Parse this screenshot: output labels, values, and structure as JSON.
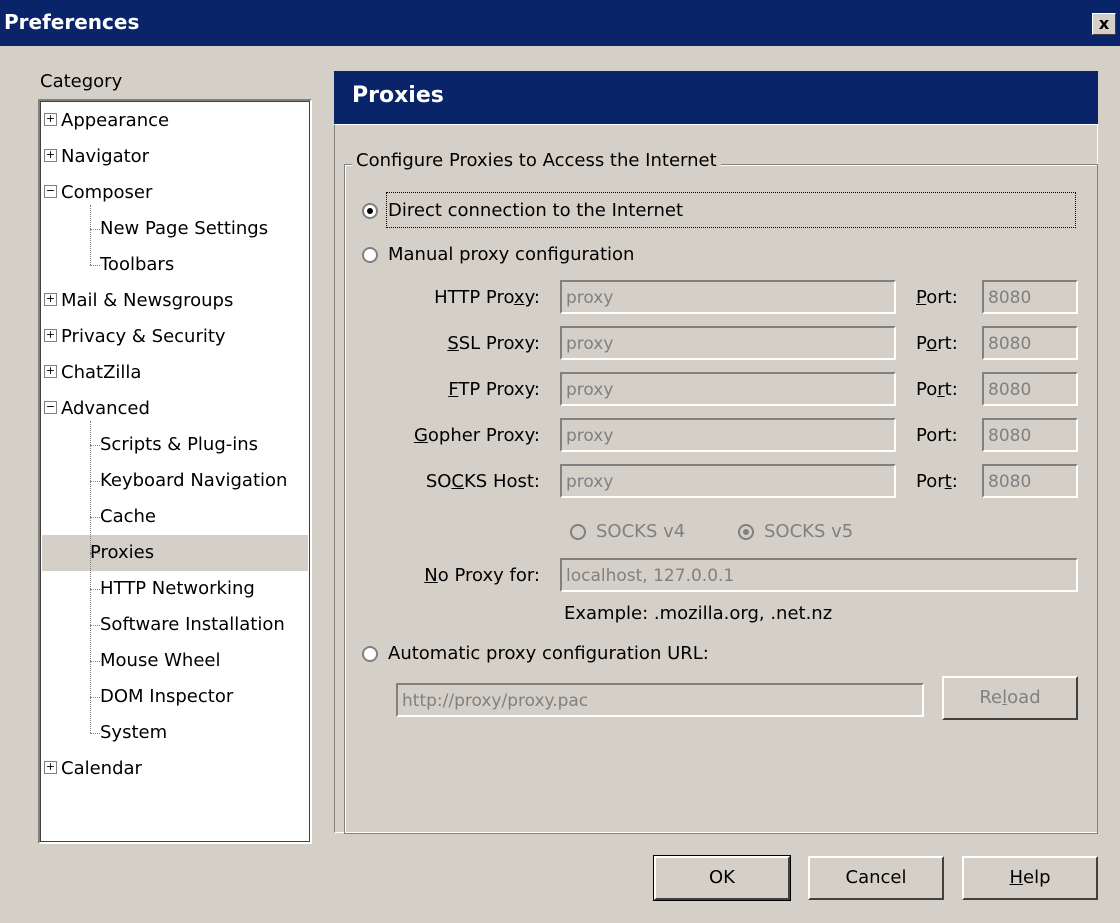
{
  "window": {
    "title": "Preferences",
    "close_symbol": "x"
  },
  "category": {
    "label": "Category",
    "items": [
      {
        "label": "Appearance",
        "expander": "+"
      },
      {
        "label": "Navigator",
        "expander": "+"
      },
      {
        "label": "Composer",
        "expander": "-"
      },
      {
        "label": "New Page Settings"
      },
      {
        "label": "Toolbars"
      },
      {
        "label": "Mail & Newsgroups",
        "expander": "+"
      },
      {
        "label": "Privacy & Security",
        "expander": "+"
      },
      {
        "label": "ChatZilla",
        "expander": "+"
      },
      {
        "label": "Advanced",
        "expander": "-"
      },
      {
        "label": "Scripts & Plug-ins"
      },
      {
        "label": "Keyboard Navigation"
      },
      {
        "label": "Cache"
      },
      {
        "label": "Proxies",
        "selected": true
      },
      {
        "label": "HTTP Networking"
      },
      {
        "label": "Software Installation"
      },
      {
        "label": "Mouse Wheel"
      },
      {
        "label": "DOM Inspector"
      },
      {
        "label": "System"
      },
      {
        "label": "Calendar",
        "expander": "+"
      }
    ]
  },
  "panel": {
    "title": "Proxies",
    "group_title": "Configure Proxies to Access the Internet",
    "options": {
      "direct": "Direct connection to the Internet",
      "manual": "Manual proxy configuration",
      "auto": "Automatic proxy configuration URL:"
    },
    "proxies": [
      {
        "pre": "HTTP Pro",
        "key": "x",
        "post": "y:",
        "value": "proxy",
        "port_pre": "",
        "port_key": "P",
        "port_post": "ort:",
        "port": "8080"
      },
      {
        "pre": "",
        "key": "S",
        "post": "SL Proxy:",
        "value": "proxy",
        "port_pre": "P",
        "port_key": "o",
        "port_post": "rt:",
        "port": "8080"
      },
      {
        "pre": "",
        "key": "F",
        "post": "TP Proxy:",
        "value": "proxy",
        "port_pre": "Po",
        "port_key": "r",
        "port_post": "t:",
        "port": "8080"
      },
      {
        "pre": "",
        "key": "G",
        "post": "opher Proxy:",
        "value": "proxy",
        "port_pre": "Port:",
        "port_key": "",
        "port_post": "",
        "port": "8080"
      },
      {
        "pre": "SO",
        "key": "C",
        "post": "KS Host:",
        "value": "proxy",
        "port_pre": "Por",
        "port_key": "t",
        "port_post": ":",
        "port": "8080"
      }
    ],
    "socks_v4": "SOCKS v4",
    "socks_v5": "SOCKS v5",
    "no_proxy": {
      "key": "N",
      "post": "o Proxy for:",
      "value": "localhost, 127.0.0.1"
    },
    "example": "Example: .mozilla.org, .net.nz",
    "auto_url": "http://proxy/proxy.pac",
    "reload": {
      "pre": "Re",
      "key": "l",
      "post": "oad"
    }
  },
  "buttons": {
    "ok": "OK",
    "cancel": "Cancel",
    "help_key": "H",
    "help_post": "elp"
  }
}
